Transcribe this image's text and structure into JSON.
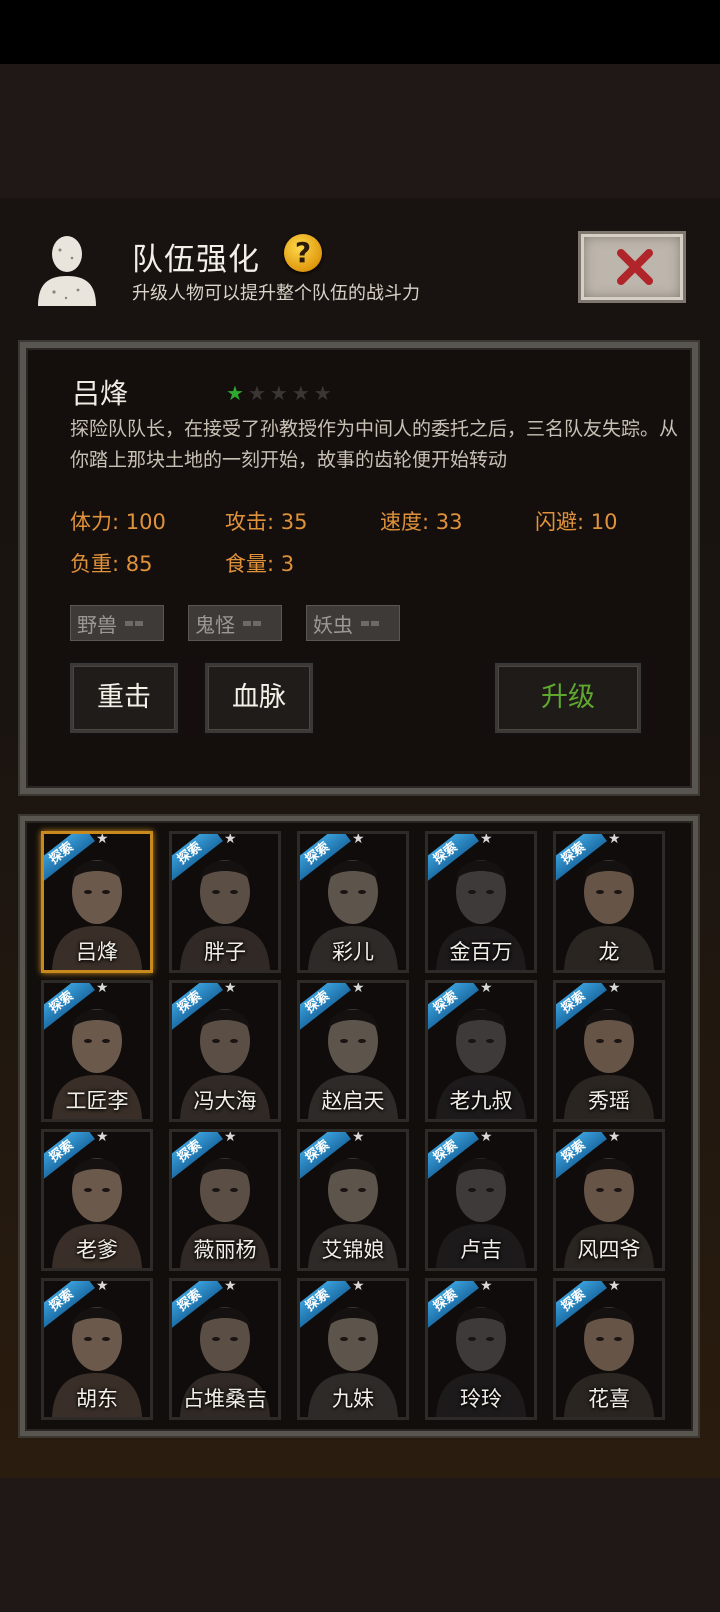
{
  "header": {
    "title": "队伍强化",
    "help_symbol": "?",
    "subtitle": "升级人物可以提升整个队伍的战斗力",
    "close_icon": "close-x-icon"
  },
  "character": {
    "name": "吕烽",
    "stars_total": 5,
    "stars_filled": 1,
    "description": "探险队队长，在接受了孙教授作为中间人的委托之后，三名队友失踪。从你踏上那块土地的一刻开始，故事的齿轮便开始转动",
    "stats": {
      "stamina": "体力: 100",
      "attack": "攻击: 35",
      "speed": "速度: 33",
      "dodge": "闪避: 10",
      "load": "负重: 85",
      "food": "食量: 3"
    },
    "tags": [
      "野兽",
      "鬼怪",
      "妖虫"
    ]
  },
  "buttons": {
    "heavy_strike": "重击",
    "bloodline": "血脉",
    "upgrade": "升级"
  },
  "roster": {
    "badge": "探索",
    "members": [
      "吕烽",
      "胖子",
      "彩儿",
      "金百万",
      "龙",
      "工匠李",
      "冯大海",
      "赵启天",
      "老九叔",
      "秀瑶",
      "老爹",
      "薇丽杨",
      "艾锦娘",
      "卢吉",
      "风四爷",
      "胡东",
      "占堆桑吉",
      "九妹",
      "玲玲",
      "花喜"
    ],
    "selected": "吕烽"
  },
  "colors": {
    "stat_text": "#e0923a",
    "upgrade_text": "#5fa72e",
    "star_on": "#2fa92f",
    "selected_border": "#c88a1c",
    "badge_blue": "#2a86c4"
  }
}
